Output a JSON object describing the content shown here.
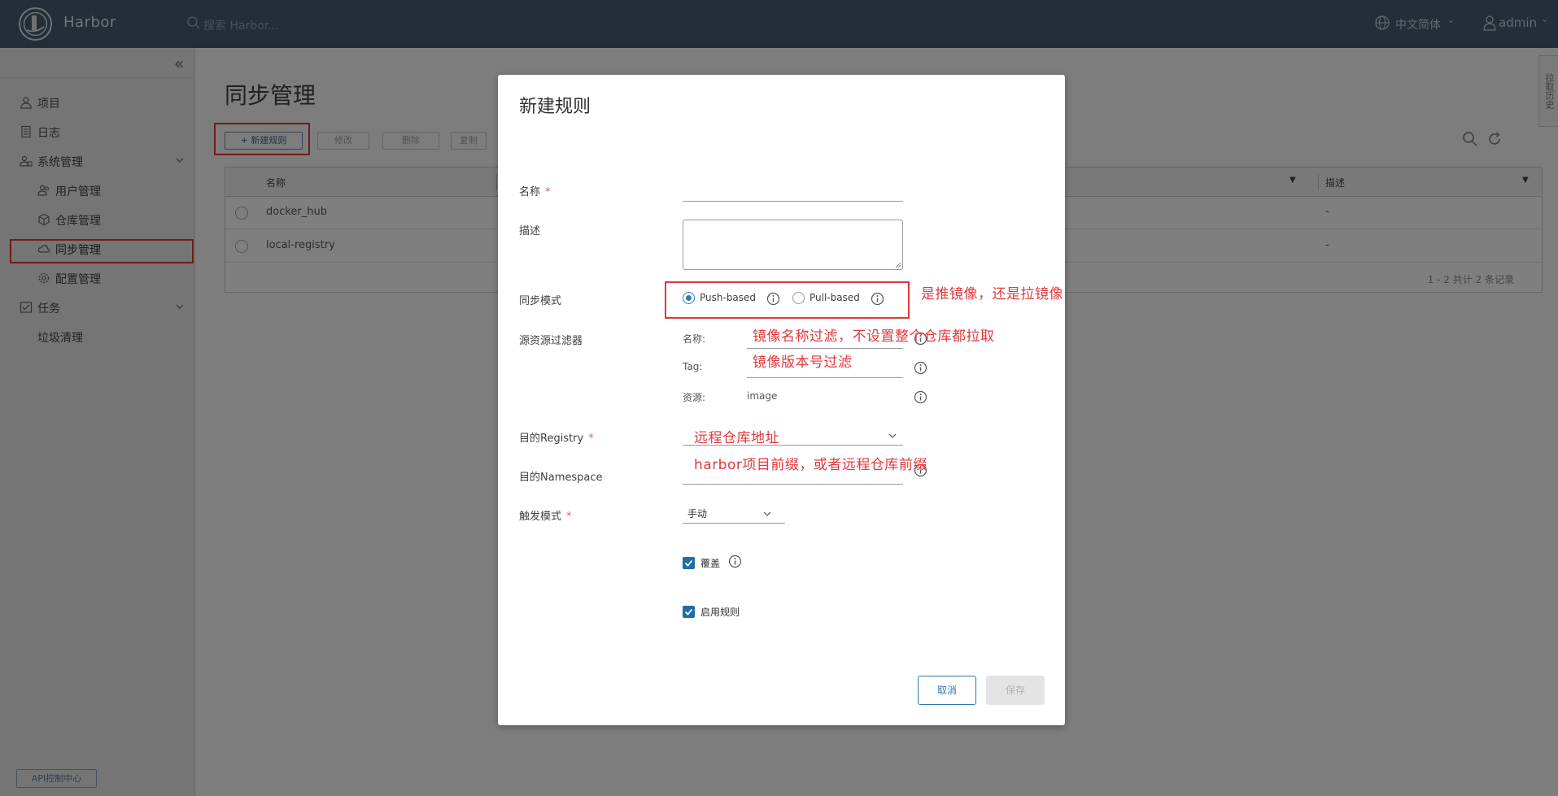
{
  "header": {
    "brand": "Harbor",
    "search_placeholder": "搜索 Harbor...",
    "language": "中文简体",
    "user": "admin"
  },
  "sidebar": {
    "items": [
      {
        "label": "项目",
        "icon": "user-icon"
      },
      {
        "label": "日志",
        "icon": "document-icon"
      },
      {
        "label": "系统管理",
        "icon": "users-icon"
      },
      {
        "label": "用户管理",
        "icon": "users-icon"
      },
      {
        "label": "仓库管理",
        "icon": "box-icon"
      },
      {
        "label": "同步管理",
        "icon": "cloud-sync-icon"
      },
      {
        "label": "配置管理",
        "icon": "gear-icon"
      },
      {
        "label": "任务",
        "icon": "checkbox-list-icon"
      },
      {
        "label": "垃圾清理",
        "icon": ""
      }
    ],
    "api_button": "API控制中心"
  },
  "main": {
    "title": "同步管理",
    "toolbar": {
      "new_rule": "+ 新建规则",
      "edit": "修改",
      "delete": "删除",
      "copy": "复制"
    },
    "table": {
      "col_name": "名称",
      "col_desc": "描述",
      "rows": [
        {
          "name": "docker_hub",
          "desc": "-"
        },
        {
          "name": "local-registry",
          "desc": "-"
        }
      ],
      "footer": "1 - 2 共计 2 条记录"
    },
    "right_tab": "拉取历史"
  },
  "modal": {
    "title": "新建规则",
    "name_label": "名称",
    "required_mark": "*",
    "desc_label": "描述",
    "sync_mode_label": "同步模式",
    "push_based": "Push-based",
    "pull_based": "Pull-based",
    "source_filter_label": "源资源过滤器",
    "filter_name": "名称:",
    "filter_tag": "Tag:",
    "filter_resource": "资源:",
    "filter_resource_value": "image",
    "dest_registry_label": "目的Registry",
    "dest_namespace_label": "目的Namespace",
    "trigger_label": "触发模式",
    "trigger_value": "手动",
    "override_label": "覆盖",
    "enable_label": "启用规则",
    "cancel": "取消",
    "save": "保存"
  },
  "annotations": {
    "push_pull": "是推镜像，还是拉镜像",
    "name_filter": "镜像名称过滤，不设置整个仓库都拉取",
    "tag_filter": "镜像版本号过滤",
    "registry": "远程仓库地址",
    "namespace": "harbor项目前缀，或者远程仓库前缀"
  },
  "colors": {
    "header_bg": "#485c70",
    "accent": "#2b77b5",
    "annotation_red": "#e0393e"
  }
}
